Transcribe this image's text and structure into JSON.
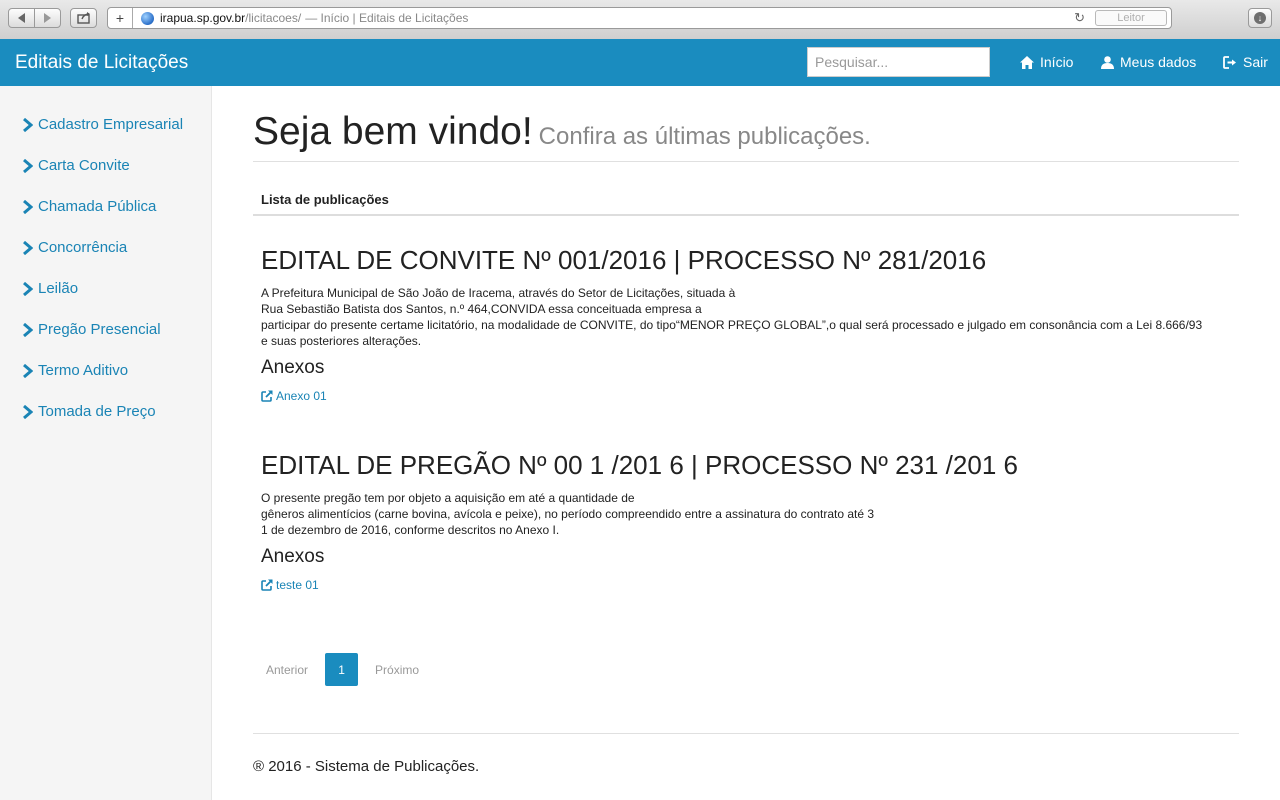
{
  "browser": {
    "url_host": "irapua.sp.gov.br",
    "url_path": "/licitacoes/",
    "page_title": "— Início | Editais de Licitações",
    "reader_label": "Leitor"
  },
  "navbar": {
    "brand": "Editais de Licitações",
    "search_placeholder": "Pesquisar...",
    "links": [
      {
        "label": "Início",
        "icon": "home-icon"
      },
      {
        "label": "Meus dados",
        "icon": "user-icon"
      },
      {
        "label": "Sair",
        "icon": "logout-icon"
      }
    ]
  },
  "sidebar": {
    "items": [
      {
        "label": "Cadastro Empresarial"
      },
      {
        "label": "Carta Convite"
      },
      {
        "label": "Chamada Pública"
      },
      {
        "label": "Concorrência"
      },
      {
        "label": "Leilão"
      },
      {
        "label": "Pregão Presencial"
      },
      {
        "label": "Termo Aditivo"
      },
      {
        "label": "Tomada de Preço"
      }
    ]
  },
  "main": {
    "heading": "Seja bem vindo!",
    "subheading": "Confira as últimas publicações.",
    "list_title": "Lista de publicações",
    "publications": [
      {
        "title": "EDITAL DE CONVITE Nº 001/2016 | PROCESSO Nº 281/2016",
        "body_lines": [
          "A Prefeitura Municipal de São João de Iracema, através do Setor de Licitações, situada à",
          "Rua Sebastião Batista dos Santos, n.º 464,CONVIDA essa conceituada empresa a",
          "participar do presente certame licitatório, na modalidade de CONVITE, do tipo“MENOR PREÇO GLOBAL”,o qual será processado e julgado em consonância com a Lei 8.666/93",
          "e suas posteriores alterações."
        ],
        "annex_heading": "Anexos",
        "attachment": "Anexo 01"
      },
      {
        "title": "EDITAL DE PREGÃO Nº 00 1 /201 6 | PROCESSO Nº 231 /201 6",
        "body_lines": [
          "O presente pregão tem por objeto a aquisição em até a quantidade de",
          "gêneros alimentícios (carne bovina, avícola e peixe), no período compreendido entre a assinatura do contrato até 3",
          "1 de dezembro de 2016, conforme descritos no Anexo I."
        ],
        "annex_heading": "Anexos",
        "attachment": "teste 01"
      }
    ],
    "pagination": {
      "prev": "Anterior",
      "current": "1",
      "next": "Próximo"
    },
    "footer": "® 2016 - Sistema de Publicações."
  },
  "colors": {
    "primary": "#1a8cbf",
    "link": "#1a84b5",
    "sidebar_bg": "#f5f5f5"
  }
}
